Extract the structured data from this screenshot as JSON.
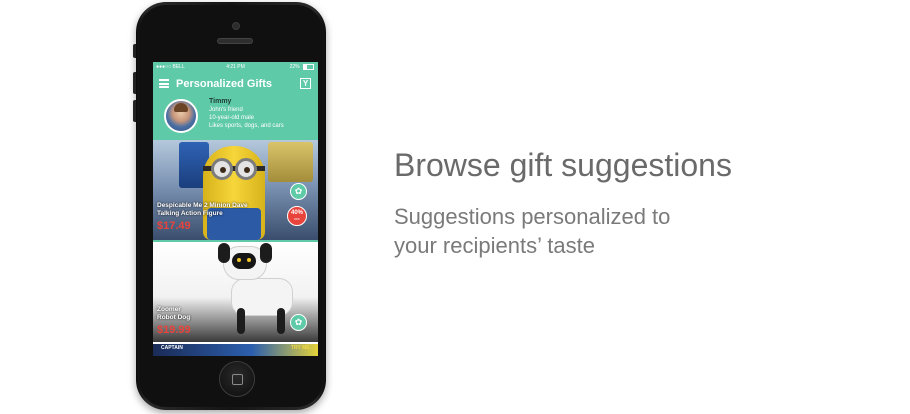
{
  "status_bar": {
    "carrier": "●●●○○ BELL",
    "time": "4:21 PM",
    "battery": "22%"
  },
  "app_bar": {
    "title": "Personalized Gifts",
    "menu_icon": "hamburger-menu-icon",
    "filter_icon": "filter-icon"
  },
  "recipient": {
    "name": "Timmy",
    "relation": "John's friend",
    "age_gender": "10-year-old male",
    "interests": "Likes sports, dogs, and cars"
  },
  "products": [
    {
      "name_line1": "Despicable Me 2 Minion Dave",
      "name_line2": "Talking Action Figure",
      "price": "$17.49",
      "discount": "40%",
      "discount_sub": "OFF",
      "action_icon": "gift-icon"
    },
    {
      "name_line1": "Zoomer",
      "name_line2": "Robot Dog",
      "price": "$19.99",
      "action_icon": "gift-icon"
    },
    {
      "name_line1": "CAPTAIN",
      "name_line2": "TRY ME"
    }
  ],
  "promo": {
    "headline": "Browse gift suggestions",
    "sub_line1": "Suggestions personalized to",
    "sub_line2": "your recipients’ taste"
  },
  "colors": {
    "brand": "#5fcaa7",
    "price": "#e8443c",
    "headline": "#6a6a6a"
  }
}
